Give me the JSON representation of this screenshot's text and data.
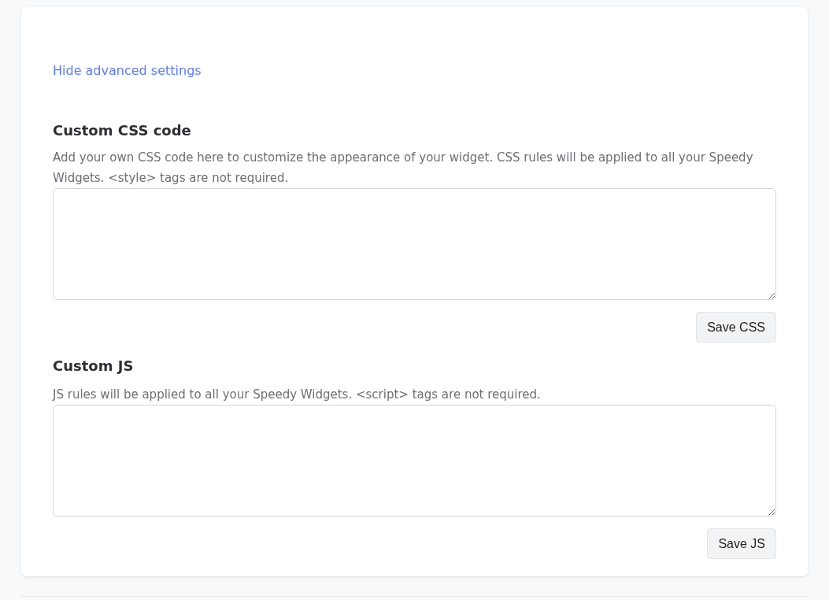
{
  "toggle_link": "Hide advanced settings",
  "sections": [
    {
      "title": "Custom CSS code",
      "description": "Add your own CSS code here to customize the appearance of your widget. CSS rules will be applied to all your Speedy Widgets. <style> tags are not required.",
      "button": "Save CSS"
    },
    {
      "title": "Custom JS",
      "description": "JS rules will be applied to all your Speedy Widgets. <script> tags are not required.",
      "button": "Save JS"
    }
  ]
}
